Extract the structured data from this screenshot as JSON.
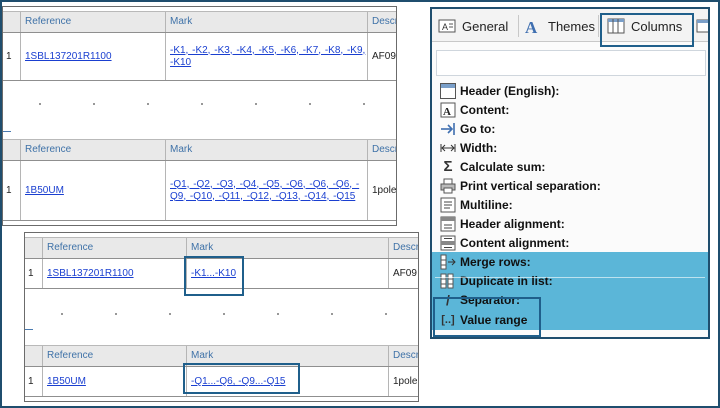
{
  "table_columns": {
    "reference": "Reference",
    "mark": "Mark",
    "description_cut": "Descr"
  },
  "panel_a": {
    "rows": [
      {
        "index": "1",
        "reference": "1SBL137201R1100",
        "mark": "-K1, -K2, -K3, -K4, -K5, -K6, -K7, -K8, -K9, -K10",
        "description": "AF09"
      },
      {
        "index": "1",
        "reference": "1B50UM",
        "mark": "-Q1, -Q2, -Q3, -Q4, -Q5, -Q6, -Q6, -Q6, -Q9, -Q10, -Q11, -Q12, -Q13, -Q14, -Q15",
        "description": "1pole"
      }
    ]
  },
  "panel_b": {
    "rows": [
      {
        "index": "1",
        "reference": "1SBL137201R1100",
        "mark": "-K1...-K10",
        "description": "AF09"
      },
      {
        "index": "1",
        "reference": "1B50UM",
        "mark": "-Q1...-Q6, -Q9...-Q15",
        "description": "1pole"
      }
    ]
  },
  "properties": {
    "tabs": [
      {
        "label": "General",
        "icon": "text-format-icon"
      },
      {
        "label": "Themes",
        "icon": "font-a-icon"
      },
      {
        "label": "Columns",
        "icon": "columns-icon"
      }
    ],
    "items": [
      {
        "label": "Header (English):",
        "icon": "table-header-icon",
        "selected": false
      },
      {
        "label": "Content:",
        "icon": "text-content-icon",
        "selected": false
      },
      {
        "label": "Go to:",
        "icon": "arrow-goto-icon",
        "selected": false
      },
      {
        "label": "Width:",
        "icon": "width-arrows-icon",
        "selected": false
      },
      {
        "label": "Calculate sum:",
        "icon": "sigma-icon",
        "selected": false
      },
      {
        "label": "Print vertical separation:",
        "icon": "print-icon",
        "selected": false
      },
      {
        "label": "Multiline:",
        "icon": "multiline-icon",
        "selected": false
      },
      {
        "label": "Header alignment:",
        "icon": "header-align-icon",
        "selected": false
      },
      {
        "label": "Content alignment:",
        "icon": "content-align-icon",
        "selected": false
      },
      {
        "label": "Merge rows:",
        "icon": "merge-rows-icon",
        "selected": true
      },
      {
        "label": "Duplicate in list:",
        "icon": "duplicate-list-icon",
        "selected": true
      },
      {
        "label": "Separator:",
        "icon": "separator-slash-icon",
        "selected": true
      },
      {
        "label": "Value range",
        "icon": "value-range-brackets-icon",
        "selected": true
      }
    ]
  },
  "colors": {
    "link": "#1a3fd0",
    "header_text": "#3f72a8",
    "selection": "#5bb6d8",
    "highlight_border": "#1f5f8b"
  }
}
